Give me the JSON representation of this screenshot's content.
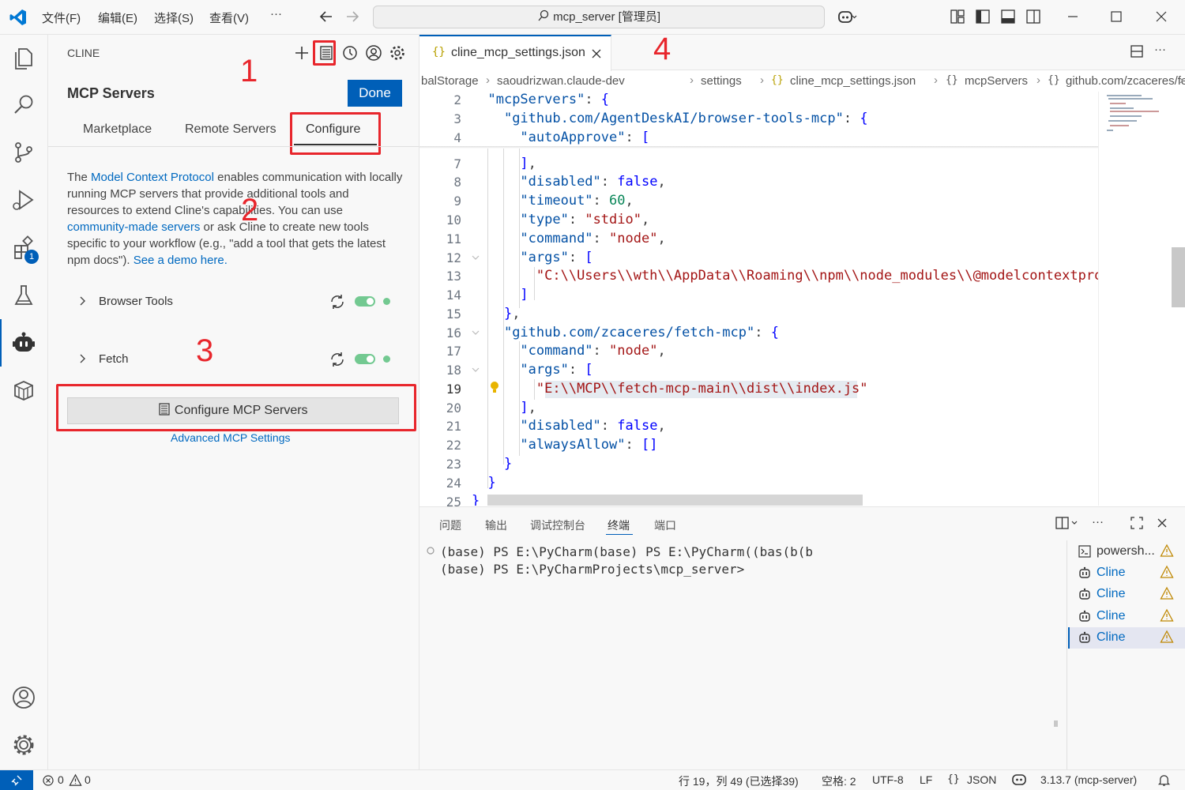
{
  "titlebar": {
    "menus": [
      "文件(F)",
      "编辑(E)",
      "选择(S)",
      "查看(V)"
    ],
    "more": "···",
    "search": "mcp_server [管理员]"
  },
  "activity": {
    "extensions_badge": "1"
  },
  "sidebar": {
    "header": "CLINE",
    "title": "MCP Servers",
    "done": "Done",
    "tabs": [
      "Marketplace",
      "Remote Servers",
      "Configure"
    ],
    "desc": {
      "p1": "The ",
      "link1": "Model Context Protocol",
      "p2": " enables communication with locally running MCP servers that provide additional tools and resources to extend Cline's capabilities. You can use ",
      "link2": "community-made servers",
      "p3": " or ask Cline to create new tools specific to your workflow (e.g., \"add a tool that gets the latest npm docs\"). ",
      "link3": "See a demo here."
    },
    "servers": [
      "Browser Tools",
      "Fetch"
    ],
    "configure_button": "Configure MCP Servers",
    "advanced": "Advanced MCP Settings"
  },
  "annotations": [
    "1",
    "2",
    "3",
    "4"
  ],
  "editor": {
    "tab": "cline_mcp_settings.json",
    "breadcrumbs": [
      "balStorage",
      "saoudrizwan.claude-dev",
      "settings",
      "cline_mcp_settings.json",
      "mcpServers",
      "github.com/zcaceres/fetch-mcp"
    ],
    "lines": [
      "2",
      "3",
      "4",
      "7",
      "8",
      "9",
      "10",
      "11",
      "12",
      "13",
      "14",
      "15",
      "16",
      "17",
      "18",
      "19",
      "20",
      "21",
      "22",
      "23",
      "24",
      "25"
    ],
    "code": {
      "mcpServers": "\"mcpServers\"",
      "browserKey": "\"github.com/AgentDeskAI/browser-tools-mcp\"",
      "autoApprove": "\"autoApprove\"",
      "disabled": "\"disabled\"",
      "false": "false",
      "timeout": "\"timeout\"",
      "sixty": "60",
      "type": "\"type\"",
      "stdio": "\"stdio\"",
      "command": "\"command\"",
      "node": "\"node\"",
      "args": "\"args\"",
      "path1": "\"C:\\\\Users\\\\wth\\\\AppData\\\\Roaming\\\\npm\\\\node_modules\\\\@modelcontextprotoc",
      "fetchKey": "\"github.com/zcaceres/fetch-mcp\"",
      "path2": "\"E:\\\\MCP\\\\fetch-mcp-main\\\\dist\\\\index.js\"",
      "alwaysAllow": "\"alwaysAllow\""
    }
  },
  "panel": {
    "tabs": [
      "问题",
      "输出",
      "调试控制台",
      "终端",
      "端口"
    ],
    "terminal_lines": [
      "(base) PS E:\\PyCharm(base) PS E:\\PyCharm((bas(b(b",
      "(base) PS E:\\PyCharmProjects\\mcp_server>"
    ],
    "terminals": [
      "powersh...",
      "Cline",
      "Cline",
      "Cline",
      "Cline"
    ]
  },
  "statusbar": {
    "errors": "0",
    "warnings": "0",
    "position": "行 19，列 49 (已选择39)",
    "spaces": "空格: 2",
    "encoding": "UTF-8",
    "eol": "LF",
    "language": "JSON",
    "version": "3.13.7 (mcp-server)"
  },
  "colors": {
    "accent": "#005fb8",
    "annotation": "#e8262c",
    "toggle": "#73c991"
  }
}
